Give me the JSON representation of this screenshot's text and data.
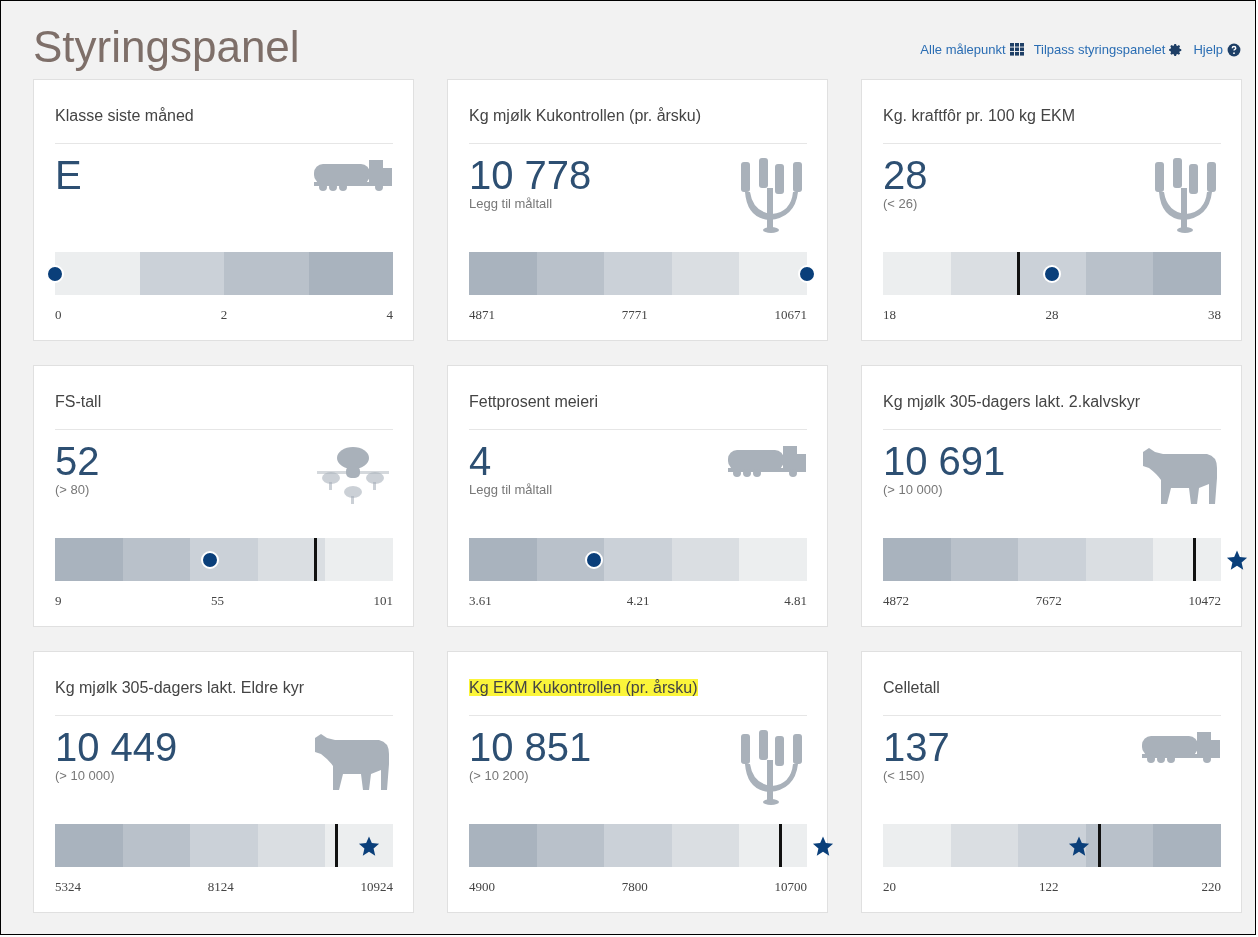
{
  "title": "Styringspanel",
  "links": [
    {
      "label": "Alle målepunkt",
      "kind": "grid"
    },
    {
      "label": "Tilpass styringspanelet",
      "kind": "gear"
    },
    {
      "label": "Hjelp",
      "kind": "help"
    }
  ],
  "cards": [
    {
      "title": "Klasse siste måned",
      "highlighted": false,
      "value": "E",
      "kind": "tanker",
      "bands": [
        {
          "color": "#eceeef"
        },
        {
          "color": "#cbd1d8"
        },
        {
          "color": "#b9c1ca"
        },
        {
          "color": "#a9b3be"
        }
      ],
      "marker": {
        "kind": "dot",
        "level": 0
      },
      "ticks": [
        "0",
        "2",
        "4"
      ]
    },
    {
      "title": "Kg mjølk Kukontrollen (pr. årsku)",
      "highlighted": false,
      "value": "10 778",
      "note": "Legg til måltall",
      "kind": "milking",
      "bands": [
        {
          "color": "#a9b3be"
        },
        {
          "color": "#b9c1ca"
        },
        {
          "color": "#cbd1d8"
        },
        {
          "color": "#dadee2"
        },
        {
          "color": "#eceeef"
        }
      ],
      "marker": {
        "kind": "dot",
        "level": 1
      },
      "ticks": [
        "4871",
        "7771",
        "10671"
      ]
    },
    {
      "title": "Kg. kraftfôr pr. 100 kg EKM",
      "highlighted": false,
      "value": "28",
      "note": "(< 26)",
      "kind": "milking",
      "bands": [
        {
          "color": "#eceeef"
        },
        {
          "color": "#dadee2"
        },
        {
          "color": "#cbd1d8"
        },
        {
          "color": "#b9c1ca"
        },
        {
          "color": "#a9b3be"
        }
      ],
      "marker": {
        "kind": "dot",
        "level": 0.5
      },
      "target": {
        "level": 0.4
      },
      "ticks": [
        "18",
        "28",
        "38"
      ]
    },
    {
      "title": "FS-tall",
      "highlighted": false,
      "value": "52",
      "note": "(> 80)",
      "kind": "flock",
      "bands": [
        {
          "color": "#a9b3be"
        },
        {
          "color": "#b9c1ca"
        },
        {
          "color": "#cbd1d8"
        },
        {
          "color": "#dadee2"
        },
        {
          "color": "#eceeef"
        }
      ],
      "marker": {
        "kind": "dot",
        "level": 0.46
      },
      "target": {
        "level": 0.77
      },
      "ticks": [
        "9",
        "55",
        "101"
      ]
    },
    {
      "title": "Fettprosent meieri",
      "highlighted": false,
      "value": "4",
      "note": "Legg til måltall",
      "kind": "tanker",
      "bands": [
        {
          "color": "#a9b3be"
        },
        {
          "color": "#b9c1ca"
        },
        {
          "color": "#cbd1d8"
        },
        {
          "color": "#dadee2"
        },
        {
          "color": "#eceeef"
        }
      ],
      "marker": {
        "kind": "dot",
        "level": 0.37
      },
      "ticks": [
        "3.61",
        "4.21",
        "4.81"
      ]
    },
    {
      "title": "Kg mjølk 305-dagers lakt. 2.kalvskyr",
      "highlighted": false,
      "value": "10 691",
      "note": "(> 10 000)",
      "kind": "cow",
      "bands": [
        {
          "color": "#a9b3be"
        },
        {
          "color": "#b9c1ca"
        },
        {
          "color": "#cbd1d8"
        },
        {
          "color": "#dadee2"
        },
        {
          "color": "#eceeef"
        }
      ],
      "marker": {
        "kind": "star",
        "level": 1,
        "overflow": true
      },
      "target": {
        "level": 0.92
      },
      "ticks": [
        "4872",
        "7672",
        "10472"
      ]
    },
    {
      "title": "Kg mjølk 305-dagers lakt. Eldre kyr",
      "highlighted": false,
      "value": "10 449",
      "note": "(> 10 000)",
      "kind": "cow",
      "bands": [
        {
          "color": "#a9b3be"
        },
        {
          "color": "#b9c1ca"
        },
        {
          "color": "#cbd1d8"
        },
        {
          "color": "#dadee2"
        },
        {
          "color": "#eceeef"
        }
      ],
      "marker": {
        "kind": "star",
        "level": 0.93,
        "overflow": false
      },
      "target": {
        "level": 0.83
      },
      "ticks": [
        "5324",
        "8124",
        "10924"
      ]
    },
    {
      "title": "Kg EKM Kukontrollen (pr. årsku)",
      "highlighted": true,
      "value": "10 851",
      "note": "(> 10 200)",
      "kind": "milking",
      "bands": [
        {
          "color": "#a9b3be"
        },
        {
          "color": "#b9c1ca"
        },
        {
          "color": "#cbd1d8"
        },
        {
          "color": "#dadee2"
        },
        {
          "color": "#eceeef"
        }
      ],
      "marker": {
        "kind": "star",
        "level": 1,
        "overflow": true
      },
      "target": {
        "level": 0.92
      },
      "ticks": [
        "4900",
        "7800",
        "10700"
      ]
    },
    {
      "title": "Celletall",
      "highlighted": false,
      "value": "137",
      "note": "(< 150)",
      "kind": "tanker",
      "bands": [
        {
          "color": "#eceeef"
        },
        {
          "color": "#dadee2"
        },
        {
          "color": "#cbd1d8"
        },
        {
          "color": "#b9c1ca"
        },
        {
          "color": "#a9b3be"
        }
      ],
      "marker": {
        "kind": "star",
        "level": 0.58,
        "overflow": false
      },
      "target": {
        "level": 0.64
      },
      "ticks": [
        "20",
        "122",
        "220"
      ]
    }
  ]
}
